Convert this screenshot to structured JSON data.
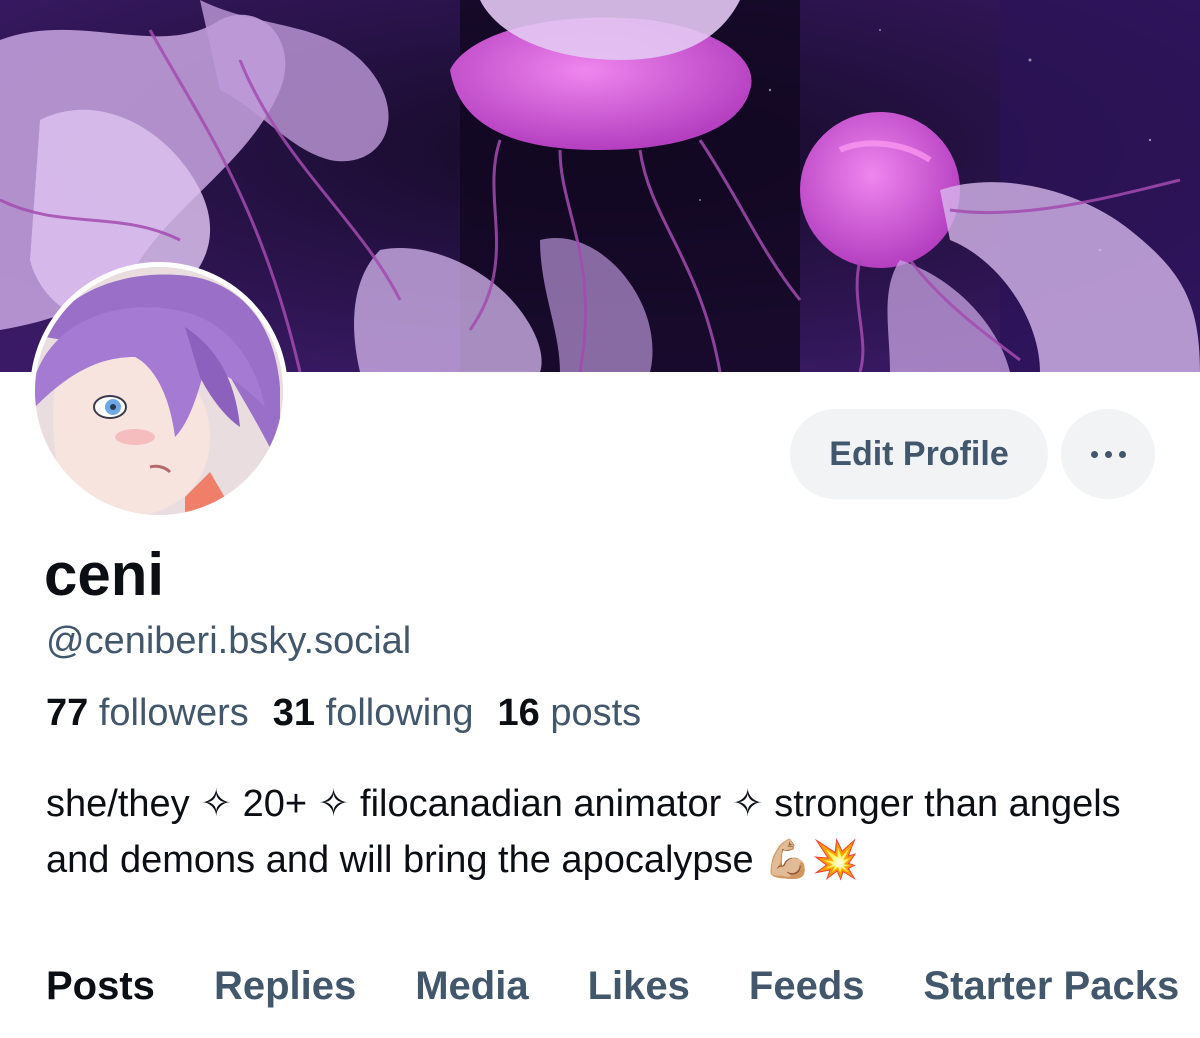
{
  "profile": {
    "display_name": "ceni",
    "handle": "@ceniberi.bsky.social",
    "bio": "she/they ✧ 20+ ✧ filocanadian animator ✧ stronger than angels and demons and will bring the apocalypse 💪🏼💥"
  },
  "stats": {
    "followers_count": "77",
    "followers_label": "followers",
    "following_count": "31",
    "following_label": "following",
    "posts_count": "16",
    "posts_label": "posts"
  },
  "actions": {
    "edit_profile_label": "Edit Profile",
    "more_icon": "ellipsis-icon"
  },
  "tabs": [
    {
      "label": "Posts",
      "active": true
    },
    {
      "label": "Replies",
      "active": false
    },
    {
      "label": "Media",
      "active": false
    },
    {
      "label": "Likes",
      "active": false
    },
    {
      "label": "Feeds",
      "active": false
    },
    {
      "label": "Starter Packs",
      "active": false
    }
  ],
  "colors": {
    "text_primary": "#0b0f14",
    "text_secondary": "#42576c",
    "button_bg": "#f1f3f5",
    "banner_bg": "#2a1448",
    "jellyfish_pink": "#d75fd8"
  }
}
